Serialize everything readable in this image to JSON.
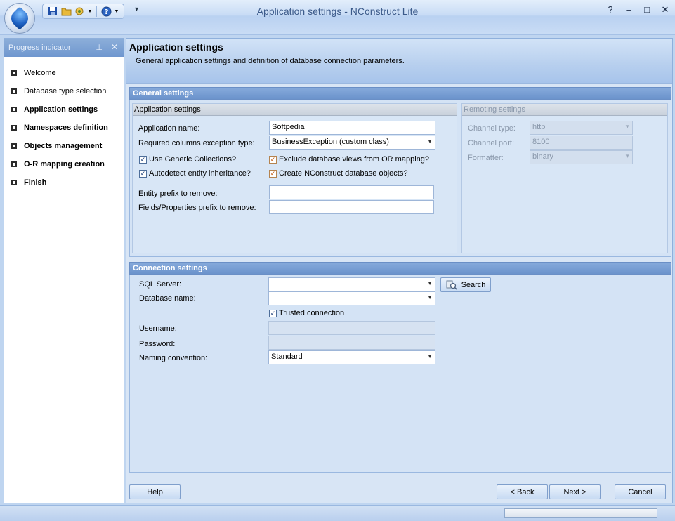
{
  "window": {
    "title": "Application settings - NConstruct  Lite",
    "qat_icons": [
      "save-icon",
      "open-folder-icon",
      "options-icon",
      "help-icon"
    ],
    "controls": {
      "help": "?",
      "minimize": "–",
      "maximize": "□",
      "close": "✕"
    }
  },
  "progress_panel": {
    "title": "Progress indicator",
    "items": [
      {
        "label": "Welcome",
        "bold": false
      },
      {
        "label": "Database type selection",
        "bold": false
      },
      {
        "label": "Application settings",
        "bold": true
      },
      {
        "label": "Namespaces definition",
        "bold": true
      },
      {
        "label": "Objects management",
        "bold": true
      },
      {
        "label": "O-R mapping creation",
        "bold": true
      },
      {
        "label": "Finish",
        "bold": true
      }
    ]
  },
  "banner": {
    "title": "Application settings",
    "description": "General application settings and definition of database connection parameters."
  },
  "general": {
    "header": "General settings",
    "app_group": {
      "title": "Application settings",
      "app_name_label": "Application name:",
      "app_name_value": "Softpedia",
      "req_cols_label": "Required columns exception type:",
      "req_cols_value": "BusinessException (custom class)",
      "use_generic": "Use Generic Collections?",
      "exclude_views": "Exclude database views from OR mapping?",
      "autodetect": "Autodetect entity inheritance?",
      "create_objects": "Create NConstruct database objects?",
      "entity_prefix_label": "Entity prefix to remove:",
      "entity_prefix_value": "",
      "fields_prefix_label": "Fields/Properties prefix to remove:",
      "fields_prefix_value": ""
    },
    "remoting_group": {
      "title": "Remoting settings",
      "channel_type_label": "Channel type:",
      "channel_type_value": "http",
      "channel_port_label": "Channel port:",
      "channel_port_value": "8100",
      "formatter_label": "Formatter:",
      "formatter_value": "binary"
    }
  },
  "connection": {
    "header": "Connection settings",
    "sql_server_label": "SQL Server:",
    "sql_server_value": "",
    "search_button": "Search",
    "database_label": "Database name:",
    "database_value": "",
    "trusted": "Trusted connection",
    "username_label": "Username:",
    "username_value": "",
    "password_label": "Password:",
    "password_value": "",
    "naming_label": "Naming convention:",
    "naming_value": "Standard"
  },
  "footer": {
    "help": "Help",
    "back": "< Back",
    "next": "Next >",
    "cancel": "Cancel"
  }
}
